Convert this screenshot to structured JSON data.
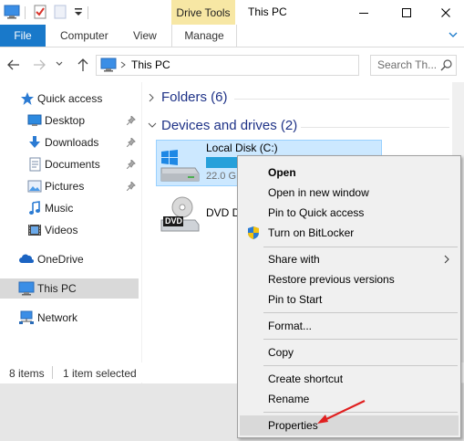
{
  "window": {
    "title": "This PC",
    "context_tab_group": "Drive Tools"
  },
  "ribbon": {
    "tabs": [
      "File",
      "Computer",
      "View",
      "Manage"
    ]
  },
  "address": {
    "path": "This PC",
    "search_placeholder": "Search Th..."
  },
  "sidebar": {
    "items": [
      {
        "label": "Quick access",
        "icon": "star-icon"
      },
      {
        "label": "Desktop",
        "icon": "desktop-icon",
        "pinned": true
      },
      {
        "label": "Downloads",
        "icon": "download-arrow-icon",
        "pinned": true
      },
      {
        "label": "Documents",
        "icon": "documents-icon",
        "pinned": true
      },
      {
        "label": "Pictures",
        "icon": "pictures-icon",
        "pinned": true
      },
      {
        "label": "Music",
        "icon": "music-note-icon"
      },
      {
        "label": "Videos",
        "icon": "film-icon"
      },
      {
        "label": "OneDrive",
        "icon": "cloud-icon"
      },
      {
        "label": "This PC",
        "icon": "computer-icon",
        "selected": true
      },
      {
        "label": "Network",
        "icon": "network-icon"
      }
    ]
  },
  "content": {
    "folders_header": "Folders (6)",
    "drives_header": "Devices and drives (2)",
    "drives": [
      {
        "name": "Local Disk (C:)",
        "free_text": "22.0 G",
        "used_fraction": 0.62,
        "selected": true
      },
      {
        "name": "DVD D",
        "icon_label": "DVD"
      }
    ]
  },
  "status": {
    "items": "8 items",
    "selected": "1 item selected"
  },
  "context_menu": {
    "items": [
      {
        "label": "Open",
        "bold": true
      },
      {
        "label": "Open in new window"
      },
      {
        "label": "Pin to Quick access"
      },
      {
        "label": "Turn on BitLocker",
        "icon": "uac-shield-icon"
      },
      {
        "label": "Share with",
        "submenu": true
      },
      {
        "label": "Restore previous versions"
      },
      {
        "label": "Pin to Start"
      },
      {
        "label": "Format..."
      },
      {
        "label": "Copy"
      },
      {
        "label": "Create shortcut"
      },
      {
        "label": "Rename"
      },
      {
        "label": "Properties",
        "hover": true
      }
    ]
  },
  "colors": {
    "accent": "#1979ca",
    "selection": "#cce8ff",
    "drive_tools": "#f7e7a4",
    "capacity_bar": "#26a0da",
    "annotation_arrow": "#e02020"
  }
}
